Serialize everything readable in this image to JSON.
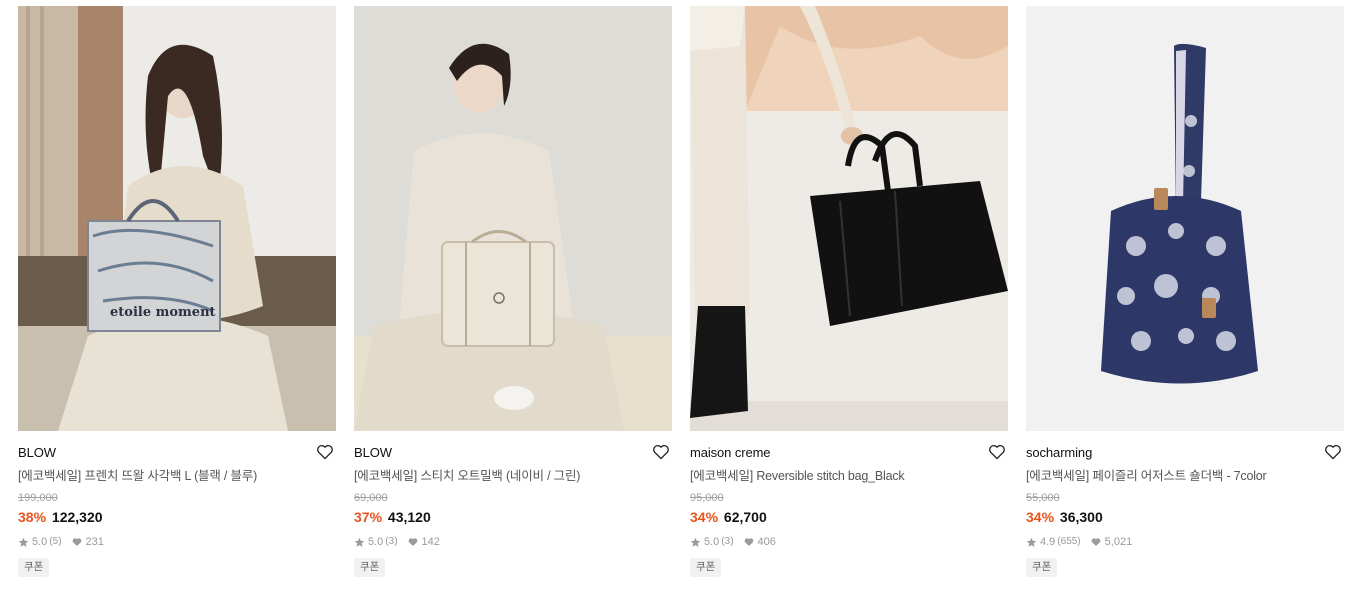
{
  "colors": {
    "accent": "#e8541e",
    "text": "#111111",
    "muted": "#999999"
  },
  "products": [
    {
      "brand": "BLOW",
      "title": "[에코백세일] 프렌치 뜨왈 사각백 L (블랙 / 블루)",
      "original_price": "199,000",
      "discount": "38%",
      "price": "122,320",
      "rating": "5.0",
      "review_count": "(5)",
      "likes": "231",
      "badge": "쿠폰",
      "bag_print": "etoile moment"
    },
    {
      "brand": "BLOW",
      "title": "[에코백세일] 스티치 오트밀백 (네이비 / 그린)",
      "original_price": "69,000",
      "discount": "37%",
      "price": "43,120",
      "rating": "5.0",
      "review_count": "(3)",
      "likes": "142",
      "badge": "쿠폰"
    },
    {
      "brand": "maison creme",
      "title": "[에코백세일] Reversible stitch bag_Black",
      "original_price": "95,000",
      "discount": "34%",
      "price": "62,700",
      "rating": "5.0",
      "review_count": "(3)",
      "likes": "406",
      "badge": "쿠폰"
    },
    {
      "brand": "socharming",
      "title": "[에코백세일] 페이즐리 어저스트 숄더백 - 7color",
      "original_price": "55,000",
      "discount": "34%",
      "price": "36,300",
      "rating": "4.9",
      "review_count": "(655)",
      "likes": "5,021",
      "badge": "쿠폰"
    }
  ]
}
